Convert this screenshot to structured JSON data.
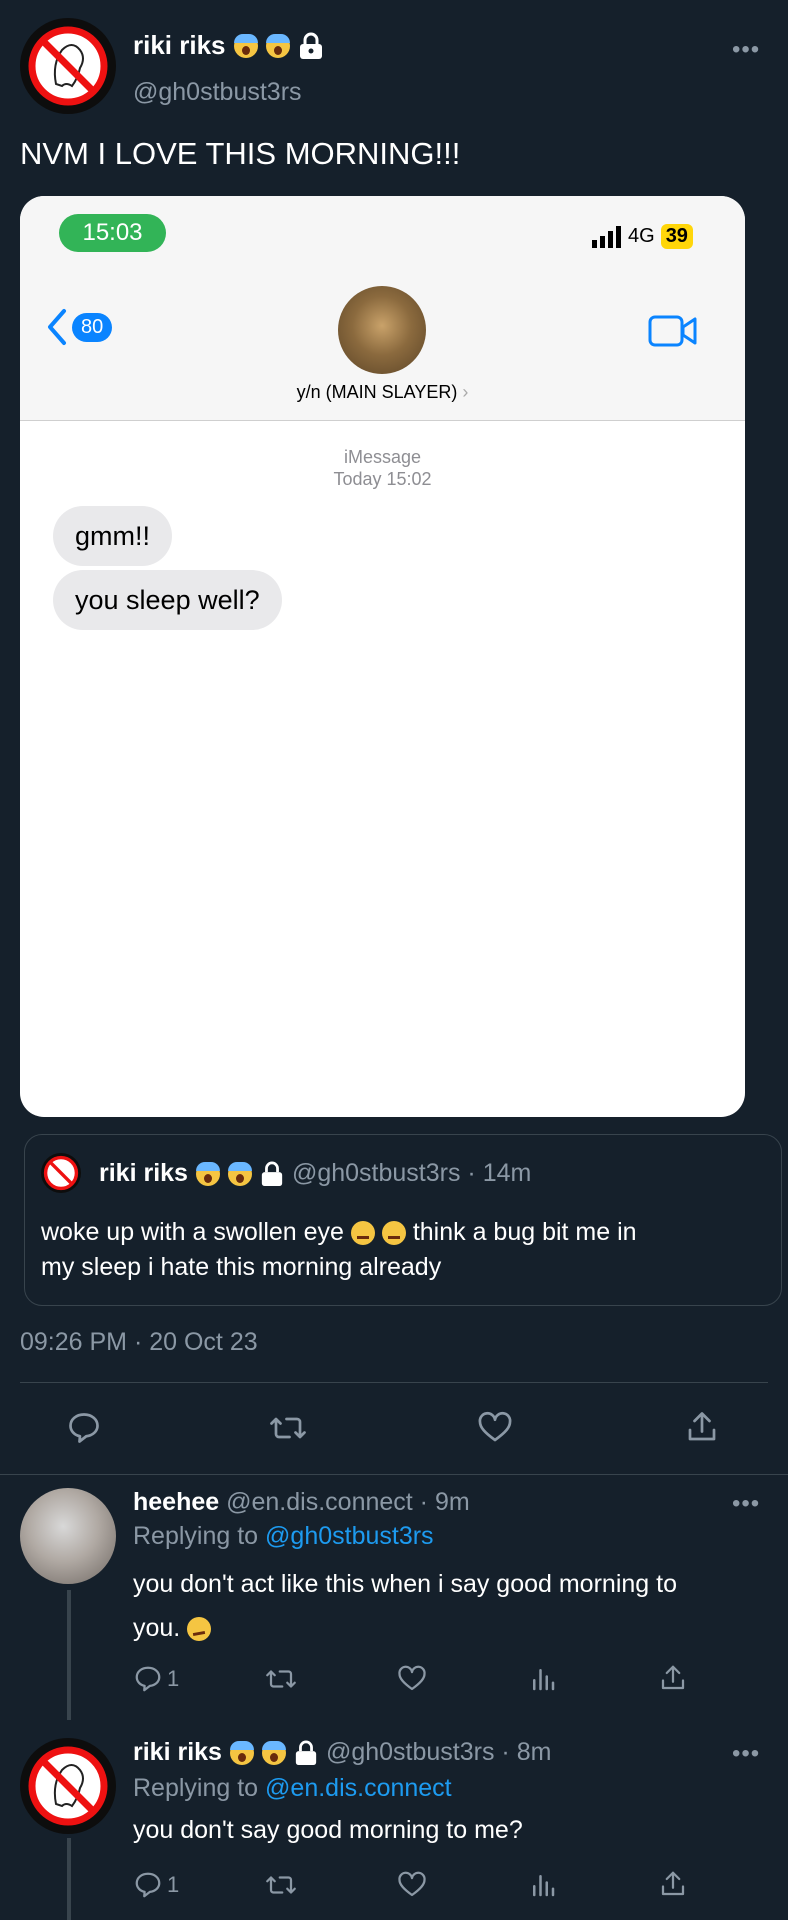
{
  "main_tweet": {
    "name": "riki riks",
    "handle": "@gh0stbust3rs",
    "text": "NVM I LOVE THIS MORNING!!!",
    "timestamp": "09:26 PM · 20 Oct 23"
  },
  "screenshot": {
    "status_time": "15:03",
    "network": "4G",
    "battery": "39",
    "back_count": "80",
    "contact_name": "y/n (MAIN SLAYER)",
    "service": "iMessage",
    "date_line": "Today 15:02",
    "messages": [
      "gmm!!",
      "you sleep well?"
    ]
  },
  "quoted_tweet": {
    "name": "riki riks",
    "meta": "@gh0stbust3rs · 14m",
    "text_part1": "woke up with a swollen eye",
    "text_part2": "think a bug bit me in",
    "text_line2": "my sleep i hate this morning already"
  },
  "reply1": {
    "name": "heehee",
    "meta": "@en.dis.connect · 9m",
    "replying_prefix": "Replying to",
    "replying_to": "@gh0stbust3rs",
    "text_line1": "you don't act like this when i say good morning to",
    "text_line2": "you.",
    "reply_count": "1"
  },
  "reply2": {
    "name": "riki riks",
    "meta": "@gh0stbust3rs · 8m",
    "replying_prefix": "Replying to",
    "replying_to": "@en.dis.connect",
    "text": "you don't say good morning to me?",
    "reply_count": "1"
  },
  "more_glyph": "•••",
  "colors": {
    "background": "#15202b",
    "link": "#1d9bf0",
    "muted": "#8b98a5",
    "imessage_blue": "#0a84ff"
  },
  "icons": [
    "ghostbusters-logo-icon",
    "scream-emoji-icon",
    "lock-icon",
    "more-icon",
    "reply-icon",
    "retweet-icon",
    "like-icon",
    "analytics-icon",
    "share-icon",
    "back-chevron-icon",
    "video-call-icon",
    "signal-icon",
    "unamused-emoji-icon",
    "confused-emoji-icon"
  ]
}
